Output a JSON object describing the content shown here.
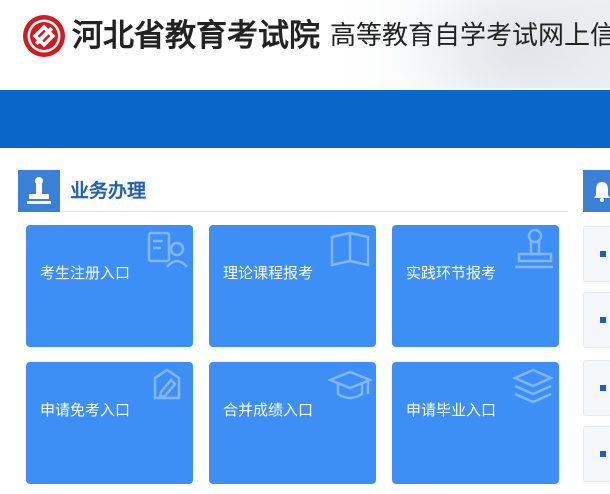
{
  "header": {
    "org_name": "河北省教育考试院",
    "system_name": "高等教育自学考试网上信"
  },
  "section": {
    "title": "业务办理"
  },
  "tiles": [
    {
      "label": "考生注册入口"
    },
    {
      "label": "理论课程报考"
    },
    {
      "label": "实践环节报考"
    },
    {
      "label": "申请免考入口"
    },
    {
      "label": "合并成绩入口"
    },
    {
      "label": "申请毕业入口"
    }
  ],
  "colors": {
    "brand_red": "#d7191f",
    "nav_blue": "#0a66c9",
    "tile_blue": "#3d8ff5",
    "title_blue": "#1e5fb4"
  },
  "icons": [
    "logo-emblem-icon",
    "stamp-icon",
    "bell-icon",
    "user-edit-icon",
    "book-icon",
    "stamp-outline-icon",
    "pen-badge-icon",
    "graduation-cap-icon",
    "layers-icon"
  ]
}
